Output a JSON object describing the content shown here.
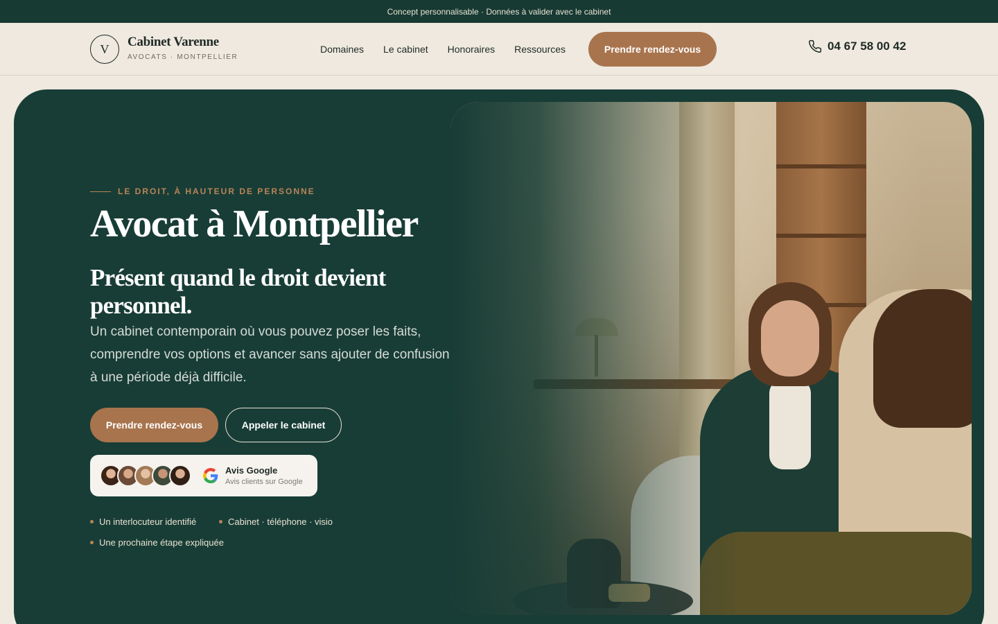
{
  "topbar": {
    "text": "Concept personnalisable · Données à valider avec le cabinet"
  },
  "header": {
    "logo_letter": "V",
    "logo_name": "Cabinet Varenne",
    "logo_sub": "AVOCATS · MONTPELLIER",
    "nav": [
      "Domaines",
      "Le cabinet",
      "Honoraires",
      "Ressources"
    ],
    "cta": "Prendre rendez-vous",
    "phone": "04 67 58 00 42"
  },
  "hero": {
    "eyebrow": "LE DROIT, À HAUTEUR DE PERSONNE",
    "title": "Avocat à Montpellier",
    "subtitle": "Présent quand le droit devient personnel.",
    "lead": "Un cabinet contemporain où vous pouvez poser les faits, comprendre vos options et avancer sans ajouter de confusion à une période déjà difficile.",
    "primary_button": "Prendre rendez-vous",
    "secondary_button": "Appeler le cabinet",
    "reviews": {
      "title": "Avis Google",
      "subtitle": "Avis clients sur Google"
    },
    "features": [
      "Un interlocuteur identifié",
      "Cabinet · téléphone · visio",
      "Une prochaine étape expliquée"
    ]
  },
  "colors": {
    "dark_green": "#183d36",
    "accent": "#a8744d",
    "cream": "#efe9df"
  }
}
